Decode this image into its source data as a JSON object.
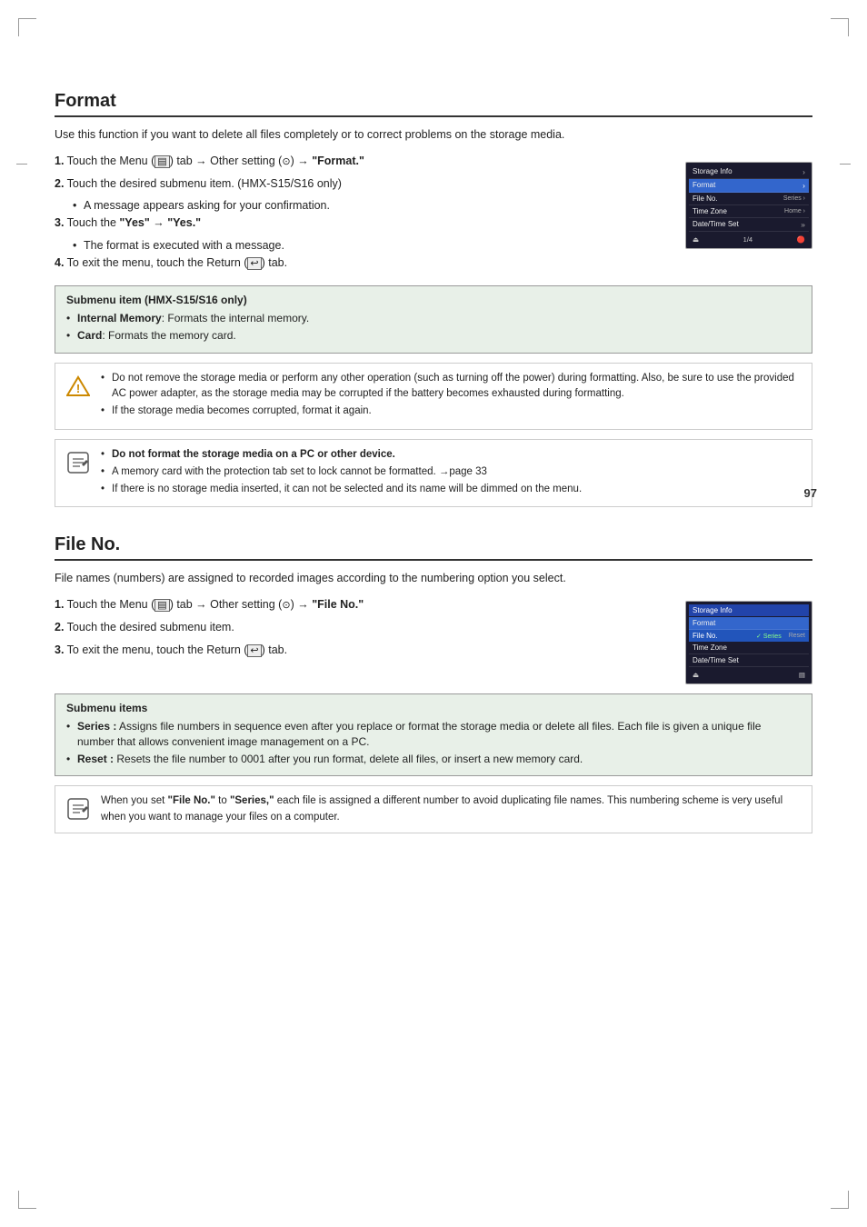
{
  "page": {
    "number": "97"
  },
  "format_section": {
    "title": "Format",
    "description": "Use this function if you want to delete all files completely or to correct problems on the storage media.",
    "steps": [
      {
        "number": "1.",
        "text": "Touch the Menu (",
        "icon_menu": "☰",
        "text2": ") tab → Other setting (",
        "icon_gear": "⚙",
        "text3": ") → \"Format.\""
      },
      {
        "number": "2.",
        "text": "Touch the desired submenu item. (HMX-S15/S16 only)"
      },
      {
        "number": "2a_sub",
        "text": "A message appears asking for your confirmation."
      },
      {
        "number": "3.",
        "text": "Touch the \"Yes\" → \"Yes.\""
      },
      {
        "number": "3a_sub",
        "text": "The format is executed with a message."
      },
      {
        "number": "4.",
        "text": "To exit the menu, touch the Return (",
        "icon_return": "⮌",
        "text2": ") tab."
      }
    ],
    "submenu_box": {
      "title": "Submenu item (HMX-S15/S16 only)",
      "items": [
        {
          "label": "Internal Memory",
          "desc": ": Formats the internal memory."
        },
        {
          "label": "Card",
          "desc": ": Formats the memory card."
        }
      ]
    },
    "warning_notice": {
      "items": [
        "Do not remove the storage media or perform any other operation (such as turning off the power) during formatting. Also, be sure to use the provided AC power adapter, as the storage media may be corrupted if the battery becomes exhausted during formatting.",
        "If the storage media becomes corrupted, format it again."
      ]
    },
    "note_notice": {
      "items": [
        "Do not format the storage media on a PC or other device.",
        "A memory card with the protection tab set to lock cannot be formatted. →page 33",
        "If there is no storage media inserted, it can not be selected and its name will be dimmed on the menu."
      ]
    },
    "camera_menu": {
      "items": [
        {
          "label": "Storage Info",
          "arrow": "›",
          "highlight": false
        },
        {
          "label": "Format",
          "arrow": "›",
          "highlight": true
        },
        {
          "label": "File No.",
          "arrow": "",
          "highlight": false
        },
        {
          "label": "Time Zone",
          "arrow": "",
          "highlight": false
        },
        {
          "label": "Date/Time Set",
          "arrow": "»",
          "highlight": false
        }
      ],
      "bottom": {
        "icon1": "⏏",
        "text1": "1/4",
        "icon2": "🔴"
      }
    }
  },
  "fileno_section": {
    "title": "File No.",
    "description": "File names (numbers) are assigned to recorded images according to the numbering option you select.",
    "steps": [
      {
        "number": "1.",
        "text": "Touch the Menu (",
        "icon_menu": "☰",
        "text2": ") tab → Other setting (",
        "icon_gear": "⚙",
        "text3": ") → \"File No.\""
      },
      {
        "number": "2.",
        "text": "Touch the desired submenu item."
      },
      {
        "number": "3.",
        "text": "To exit the menu, touch the Return (",
        "icon_return": "⮌",
        "text2": ") tab."
      }
    ],
    "submenu_box": {
      "title": "Submenu items",
      "items": [
        {
          "label": "Series :",
          "desc": "Assigns file numbers in sequence even after you replace or format the storage media or delete all files. Each file is given a unique file number that allows convenient image management on a PC."
        },
        {
          "label": "Reset :",
          "desc": "Resets the file number to 0001 after you run format, delete all files, or insert a new memory card."
        }
      ]
    },
    "note_notice": {
      "text": "When you set \"File No.\" to \"Series,\" each file is assigned a different number to avoid duplicating file names. This numbering scheme is very useful when you want to manage your files on a computer."
    },
    "camera_menu": {
      "header_label": "Storage Info",
      "check_label": "✓ Series",
      "right_label": "Reset",
      "items": [
        {
          "label": "Format",
          "highlight": false
        },
        {
          "label": "File No.",
          "highlight": true
        },
        {
          "label": "Time Zone",
          "highlight": false
        },
        {
          "label": "Date/Time Set",
          "highlight": false
        }
      ]
    }
  },
  "icons": {
    "warning_triangle": "⚠",
    "note_pencil": "✏",
    "menu_icon": "▤",
    "gear_icon": "⊙",
    "return_icon": "↩"
  }
}
